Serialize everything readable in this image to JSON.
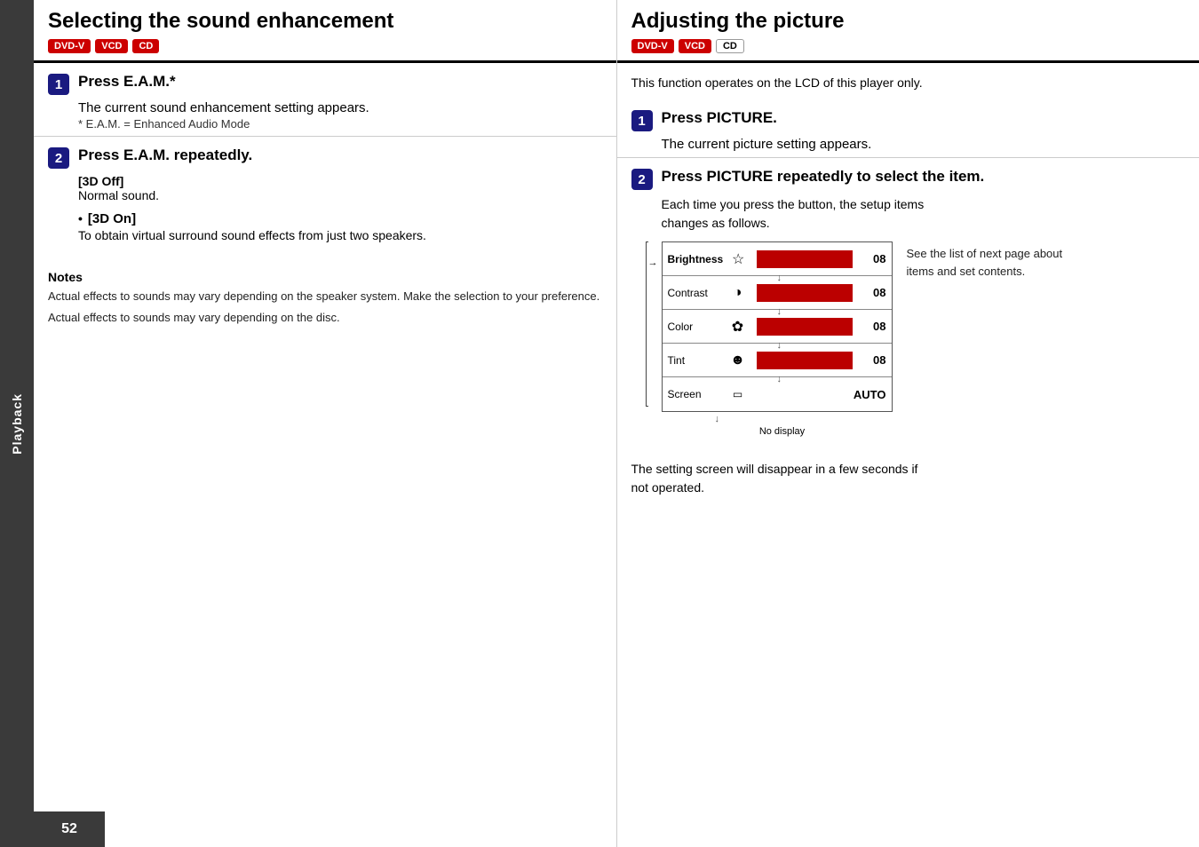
{
  "sidebar": {
    "label": "Playback"
  },
  "page_number": "52",
  "left_section": {
    "title": "Selecting the sound enhancement",
    "badges": [
      {
        "label": "DVD-V",
        "class": "badge-dvdv"
      },
      {
        "label": "VCD",
        "class": "badge-vcd"
      },
      {
        "label": "CD",
        "class": "badge-cd"
      }
    ],
    "step1": {
      "num": "1",
      "title": "Press E.A.M.*",
      "body": "The current sound enhancement setting appears.",
      "note": "* E.A.M. = Enhanced Audio Mode"
    },
    "step2": {
      "num": "2",
      "title": "Press E.A.M. repeatedly.",
      "option1_label": "[3D Off]",
      "option1_text": "Normal sound.",
      "option2_bullet": "•",
      "option2_label": "[3D On]",
      "option2_text": "To obtain virtual surround sound effects from just two speakers."
    },
    "notes": {
      "title": "Notes",
      "line1": "Actual effects to sounds may vary depending on the speaker system. Make the selection to your preference.",
      "line2": "Actual effects to sounds may vary depending on the disc."
    }
  },
  "right_section": {
    "title": "Adjusting the picture",
    "badges": [
      {
        "label": "DVD-V",
        "class": "badge-dvdv"
      },
      {
        "label": "VCD",
        "class": "badge-vcd"
      },
      {
        "label": "CD",
        "class": "badge-cd-outline"
      }
    ],
    "intro": "This function operates on the LCD of this player only.",
    "step1": {
      "num": "1",
      "title": "Press PICTURE.",
      "body": "The current picture setting appears."
    },
    "step2": {
      "num": "2",
      "title": "Press PICTURE repeatedly to select the item.",
      "body1": "Each time you press the button, the setup items",
      "body2": "changes as follows."
    },
    "diagram": {
      "rows": [
        {
          "label": "Brightness",
          "icon": "☆",
          "bar": true,
          "value": "08",
          "active": true,
          "arrow_left": true
        },
        {
          "label": "Contrast",
          "icon": "◑",
          "bar": true,
          "value": "08",
          "active": false
        },
        {
          "label": "Color",
          "icon": "✿",
          "bar": true,
          "value": "08",
          "active": false
        },
        {
          "label": "Tint",
          "icon": "☻",
          "bar": true,
          "value": "08",
          "active": false
        },
        {
          "label": "Screen",
          "icon": "▭",
          "bar": false,
          "value": "AUTO",
          "active": false
        }
      ],
      "no_display": "No display",
      "side_note": "See the list of next page about items and set contents."
    },
    "bottom_note1": "The setting screen will disappear in a few seconds if",
    "bottom_note2": "not operated."
  }
}
